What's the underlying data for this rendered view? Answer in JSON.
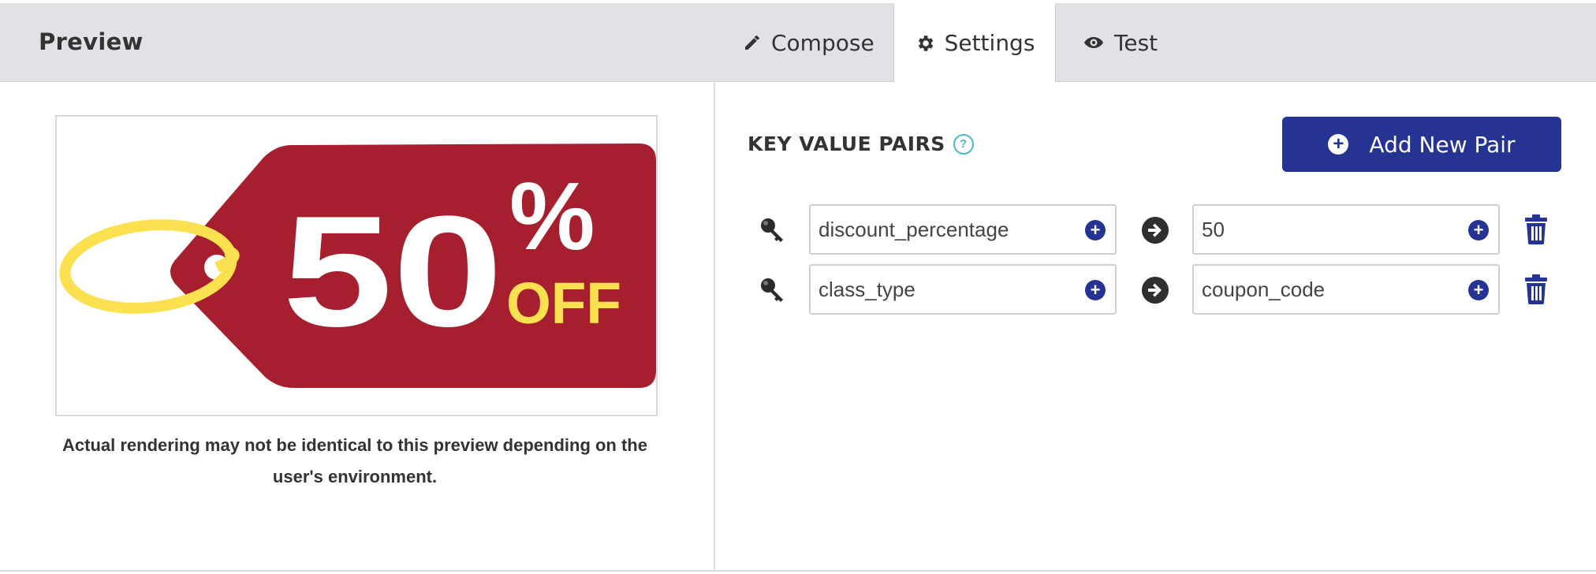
{
  "header": {
    "title": "Preview",
    "tabs": [
      {
        "label": "Compose",
        "icon": "pencil-icon"
      },
      {
        "label": "Settings",
        "icon": "gear-icon",
        "active": true
      },
      {
        "label": "Test",
        "icon": "eye-icon"
      }
    ]
  },
  "preview": {
    "tag": {
      "percent": "50",
      "percent_sign": "%",
      "off": "OFF"
    },
    "note": "Actual rendering may not be identical to this preview depending on the user's environment."
  },
  "settings": {
    "section_title": "KEY VALUE PAIRS",
    "help": "?",
    "add_button": "Add New Pair",
    "pairs": [
      {
        "key": "discount_percentage",
        "value": "50"
      },
      {
        "key": "class_type",
        "value": "coupon_code"
      }
    ]
  },
  "colors": {
    "accent": "#253392",
    "tag_red": "#a51f2e",
    "tag_yellow": "#fbe04f",
    "header_bg": "#e1e1e6"
  }
}
